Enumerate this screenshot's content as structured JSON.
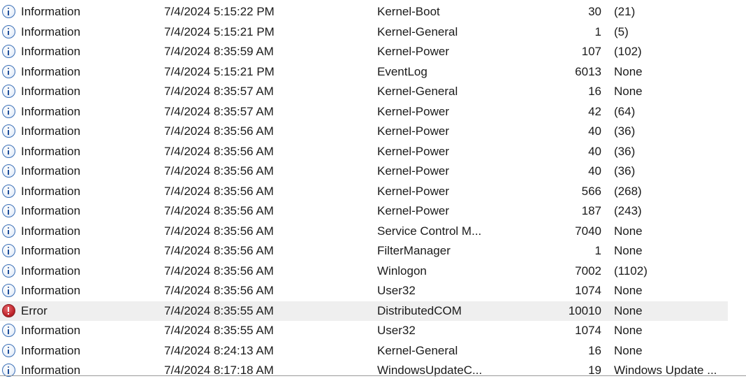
{
  "events": [
    {
      "level": "Information",
      "icon": "info-icon",
      "date": "7/4/2024 5:15:22 PM",
      "source": "Kernel-Boot",
      "event_id": "30",
      "task": "(21)"
    },
    {
      "level": "Information",
      "icon": "info-icon",
      "date": "7/4/2024 5:15:21 PM",
      "source": "Kernel-General",
      "event_id": "1",
      "task": "(5)"
    },
    {
      "level": "Information",
      "icon": "info-icon",
      "date": "7/4/2024 8:35:59 AM",
      "source": "Kernel-Power",
      "event_id": "107",
      "task": "(102)"
    },
    {
      "level": "Information",
      "icon": "info-icon",
      "date": "7/4/2024 5:15:21 PM",
      "source": "EventLog",
      "event_id": "6013",
      "task": "None"
    },
    {
      "level": "Information",
      "icon": "info-icon",
      "date": "7/4/2024 8:35:57 AM",
      "source": "Kernel-General",
      "event_id": "16",
      "task": "None"
    },
    {
      "level": "Information",
      "icon": "info-icon",
      "date": "7/4/2024 8:35:57 AM",
      "source": "Kernel-Power",
      "event_id": "42",
      "task": "(64)"
    },
    {
      "level": "Information",
      "icon": "info-icon",
      "date": "7/4/2024 8:35:56 AM",
      "source": "Kernel-Power",
      "event_id": "40",
      "task": "(36)"
    },
    {
      "level": "Information",
      "icon": "info-icon",
      "date": "7/4/2024 8:35:56 AM",
      "source": "Kernel-Power",
      "event_id": "40",
      "task": "(36)"
    },
    {
      "level": "Information",
      "icon": "info-icon",
      "date": "7/4/2024 8:35:56 AM",
      "source": "Kernel-Power",
      "event_id": "40",
      "task": "(36)"
    },
    {
      "level": "Information",
      "icon": "info-icon",
      "date": "7/4/2024 8:35:56 AM",
      "source": "Kernel-Power",
      "event_id": "566",
      "task": "(268)"
    },
    {
      "level": "Information",
      "icon": "info-icon",
      "date": "7/4/2024 8:35:56 AM",
      "source": "Kernel-Power",
      "event_id": "187",
      "task": "(243)"
    },
    {
      "level": "Information",
      "icon": "info-icon",
      "date": "7/4/2024 8:35:56 AM",
      "source": "Service Control M...",
      "event_id": "7040",
      "task": "None"
    },
    {
      "level": "Information",
      "icon": "info-icon",
      "date": "7/4/2024 8:35:56 AM",
      "source": "FilterManager",
      "event_id": "1",
      "task": "None"
    },
    {
      "level": "Information",
      "icon": "info-icon",
      "date": "7/4/2024 8:35:56 AM",
      "source": "Winlogon",
      "event_id": "7002",
      "task": "(1102)"
    },
    {
      "level": "Information",
      "icon": "info-icon",
      "date": "7/4/2024 8:35:56 AM",
      "source": "User32",
      "event_id": "1074",
      "task": "None"
    },
    {
      "level": "Error",
      "icon": "error-icon",
      "date": "7/4/2024 8:35:55 AM",
      "source": "DistributedCOM",
      "event_id": "10010",
      "task": "None",
      "selected": true
    },
    {
      "level": "Information",
      "icon": "info-icon",
      "date": "7/4/2024 8:35:55 AM",
      "source": "User32",
      "event_id": "1074",
      "task": "None"
    },
    {
      "level": "Information",
      "icon": "info-icon",
      "date": "7/4/2024 8:24:13 AM",
      "source": "Kernel-General",
      "event_id": "16",
      "task": "None"
    },
    {
      "level": "Information",
      "icon": "info-icon",
      "date": "7/4/2024 8:17:18 AM",
      "source": "WindowsUpdateC...",
      "event_id": "19",
      "task": "Windows Update ..."
    }
  ],
  "colors": {
    "info_blue": "#3b6fb6",
    "error_red": "#c0262d",
    "selected_row": "#efefef"
  }
}
